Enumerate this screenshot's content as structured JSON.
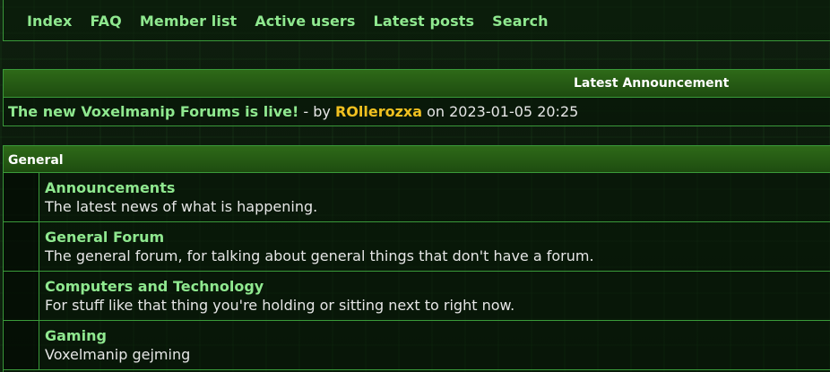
{
  "nav": {
    "items": [
      {
        "label": "Index"
      },
      {
        "label": "FAQ"
      },
      {
        "label": "Member list"
      },
      {
        "label": "Active users"
      },
      {
        "label": "Latest posts"
      },
      {
        "label": "Search"
      }
    ]
  },
  "announcement": {
    "header": "Latest Announcement",
    "post_title": "The new Voxelmanip Forums is live!",
    "by_text": " - by ",
    "author": "ROllerozxa",
    "on_text": " on 2023-01-05 20:25"
  },
  "category": {
    "name": "General",
    "forums": [
      {
        "name": "Announcements",
        "description": "The latest news of what is happening."
      },
      {
        "name": "General Forum",
        "description": "The general forum, for talking about general things that don't have a forum."
      },
      {
        "name": "Computers and Technology",
        "description": "For stuff like that thing you're holding or sitting next to right now."
      },
      {
        "name": "Gaming",
        "description": "Voxelmanip gejming"
      }
    ]
  },
  "colors": {
    "link_green": "#8fe88f",
    "author_yellow": "#f0c020",
    "header_green": "#2e6a18",
    "border_green": "#3a9a3a"
  }
}
